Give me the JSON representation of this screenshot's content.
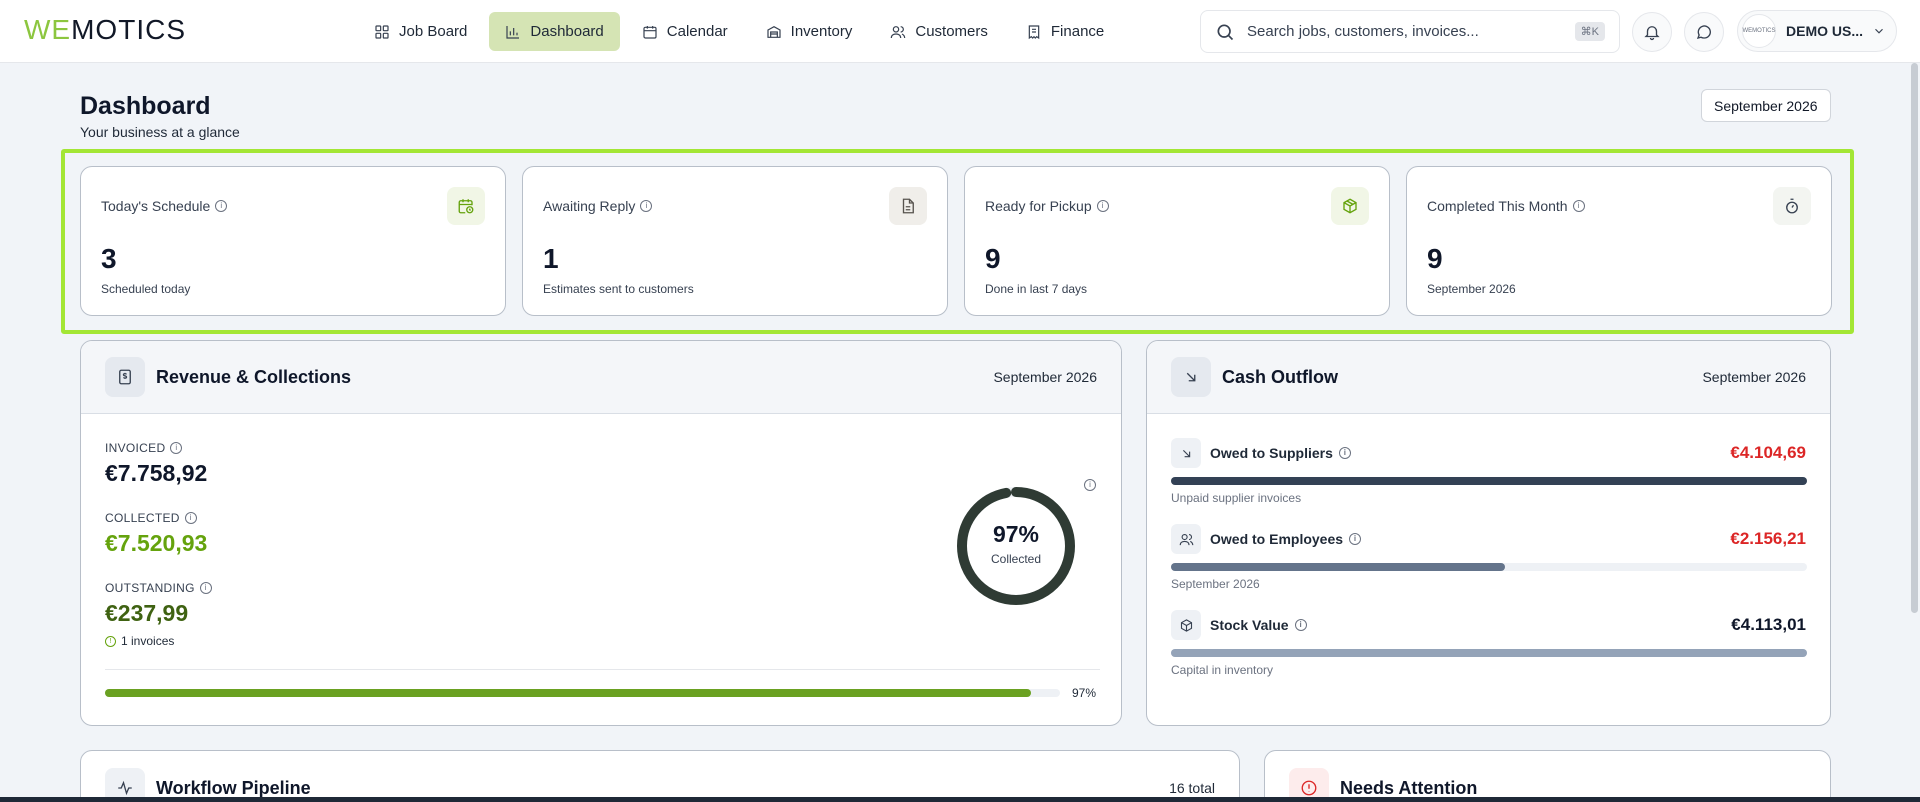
{
  "brand": {
    "logo_hl": "WE",
    "logo_rest": "MOTICS",
    "accent": "#8cc63f"
  },
  "nav": {
    "items": [
      {
        "label": "Job Board",
        "icon": "grid-icon"
      },
      {
        "label": "Dashboard",
        "icon": "bar-chart-icon",
        "active": true
      },
      {
        "label": "Calendar",
        "icon": "calendar-icon"
      },
      {
        "label": "Inventory",
        "icon": "warehouse-icon"
      },
      {
        "label": "Customers",
        "icon": "users-icon"
      },
      {
        "label": "Finance",
        "icon": "receipt-icon"
      }
    ]
  },
  "search": {
    "placeholder": "Search jobs, customers, invoices...",
    "shortcut": "⌘K"
  },
  "user": {
    "name": "DEMO US...",
    "avatar_text": "WEMOTICS"
  },
  "page": {
    "title": "Dashboard",
    "subtitle": "Your business at a glance",
    "month": "September 2026"
  },
  "kpis": [
    {
      "label": "Today's Schedule",
      "value": "3",
      "desc": "Scheduled today",
      "icon": "calendar-clock-icon",
      "icon_color": "#65a30d",
      "icon_bg": "#f1f6e6"
    },
    {
      "label": "Awaiting Reply",
      "value": "1",
      "desc": "Estimates sent to customers",
      "icon": "document-icon",
      "icon_color": "#57534e",
      "icon_bg": "#f0eeea"
    },
    {
      "label": "Ready for Pickup",
      "value": "9",
      "desc": "Done in last 7 days",
      "icon": "package-icon",
      "icon_color": "#65a30d",
      "icon_bg": "#f1f6e6"
    },
    {
      "label": "Completed This Month",
      "value": "9",
      "desc": "September 2026",
      "icon": "timer-icon",
      "icon_color": "#374151",
      "icon_bg": "#f3f5f1"
    }
  ],
  "revenue": {
    "title": "Revenue & Collections",
    "period": "September 2026",
    "invoiced_label": "INVOICED",
    "invoiced_value": "€7.758,92",
    "collected_label": "COLLECTED",
    "collected_value": "€7.520,93",
    "outstanding_label": "OUTSTANDING",
    "outstanding_value": "€237,99",
    "outstanding_note": "1 invoices",
    "collected_pct": 97,
    "collected_pct_text": "97%",
    "donut_label": "Collected",
    "bar_pct_text": "97%",
    "colors": {
      "collected": "#65a30d",
      "outstanding": "#3f6212",
      "bar": "#6aa121",
      "ring": "#2f3b34"
    }
  },
  "outflow": {
    "title": "Cash Outflow",
    "period": "September 2026",
    "rows": [
      {
        "label": "Owed to Suppliers",
        "value": "€4.104,69",
        "sub": "Unpaid supplier invoices",
        "fill_pct": 100,
        "bar_color": "#334155",
        "value_color": "#dc2626",
        "icon": "arrow-down-right-icon"
      },
      {
        "label": "Owed to Employees",
        "value": "€2.156,21",
        "sub": "September 2026",
        "fill_pct": 52.5,
        "bar_color": "#64748b",
        "value_color": "#dc2626",
        "icon": "users-icon"
      },
      {
        "label": "Stock Value",
        "value": "€4.113,01",
        "sub": "Capital in inventory",
        "fill_pct": 100,
        "bar_color": "#94a3b8",
        "value_color": "#0f172a",
        "icon": "box-icon"
      }
    ]
  },
  "workflow": {
    "title": "Workflow Pipeline",
    "total": "16 total"
  },
  "attention": {
    "title": "Needs Attention"
  }
}
